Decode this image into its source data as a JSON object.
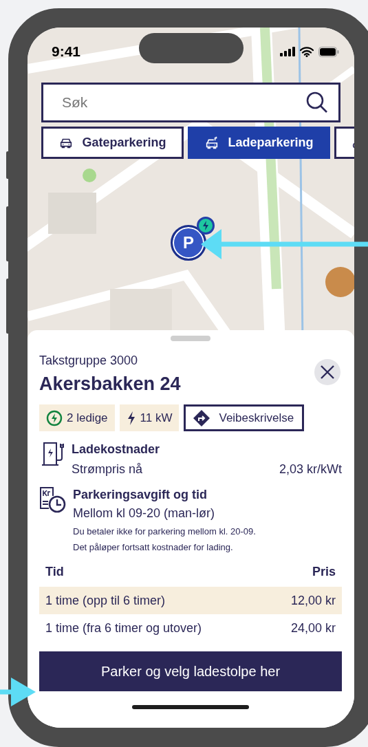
{
  "status_bar": {
    "time": "9:41"
  },
  "search": {
    "placeholder": "Søk"
  },
  "filters": [
    {
      "kind": "car",
      "label": "Gateparkering",
      "selected": false
    },
    {
      "kind": "charging-car",
      "label": "Ladeparkering",
      "selected": true
    },
    {
      "kind": "other",
      "selected": false
    }
  ],
  "map": {
    "kind": "picture",
    "marker": {
      "label": "P",
      "charging": true
    }
  },
  "sheet": {
    "subtitle": "Takstgruppe 3000",
    "title": "Akersbakken 24",
    "badges": [
      {
        "kind": "available",
        "label": "2 ledige"
      },
      {
        "kind": "power",
        "label": "11 kW"
      },
      {
        "kind": "directions",
        "label": "Veibeskrivelse"
      }
    ],
    "sections": [
      {
        "kind": "charging",
        "heading": "Ladekostnader",
        "rows": [
          {
            "label": "Strømpris nå",
            "value": "2,03 kr/kWt"
          }
        ]
      },
      {
        "kind": "parking",
        "heading": "Parkeringsavgift og tid",
        "subheading": "Mellom kl 09-20 (man-lør)",
        "notes": [
          "Du betaler ikke for parkering mellom kl. 20-09.",
          "Det påløper fortsatt kostnader for lading."
        ]
      }
    ],
    "table": {
      "columns": [
        "Tid",
        "Pris"
      ],
      "rows": [
        {
          "cells": [
            "1 time (opp til 6 timer)",
            "12,00 kr"
          ],
          "shaded": true
        },
        {
          "cells": [
            "1 time (fra 6 timer og utover)",
            "24,00 kr"
          ],
          "shaded": false
        }
      ]
    },
    "action": "Parker og velg ladestolpe her"
  }
}
